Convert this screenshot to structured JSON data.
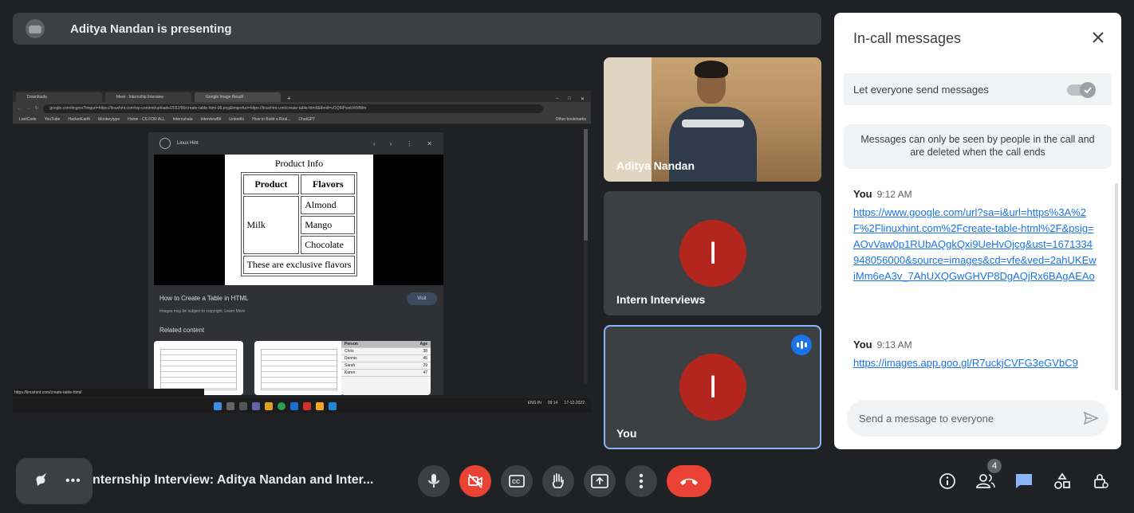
{
  "presenting": {
    "text": "Aditya Nandan is presenting"
  },
  "shared_screen": {
    "tabs": [
      "Downloads",
      "Meet - Internship Interview",
      "Google Image Result"
    ],
    "address": "google.com/imgres?imgurl=https://linuxhint.com/wp-content/uploads/2022/06/create-table-html-06.png&imgrefurl=https://linuxhint.com/create-table-html/&tbnid=vOQ6tPwsbXtMMm",
    "bookmarks": [
      "LeetCode",
      "YouTube",
      "HackerEarth",
      "Monkeytype",
      "Home - CS FOR ALL",
      "Internshala",
      "InterviewBit",
      "LinkedIn",
      "How to Build a Real...",
      "ChatGPT"
    ],
    "other_bookmarks": "Other bookmarks",
    "site_name": "Linux Hint",
    "product_table": {
      "title": "Product Info",
      "headers": [
        "Product",
        "Flavors"
      ],
      "product": "Milk",
      "flavors": [
        "Almond",
        "Mango",
        "Chocolate"
      ],
      "footer": "These are exclusive flavors"
    },
    "caption": "How to Create a Table in HTML",
    "visit": "Visit",
    "copyright": "Images may be subject to copyright. Learn More",
    "related": "Related content",
    "related_table": {
      "headers": [
        "Person",
        "Age"
      ],
      "rows": [
        [
          "Chris",
          "38"
        ],
        [
          "Dennis",
          "45"
        ],
        [
          "Sarah",
          "29"
        ],
        [
          "Karen",
          "47"
        ]
      ]
    },
    "status_url": "https://linuxhint.com/create-table-html/",
    "tray": {
      "lang": "ENG IN",
      "time": "09:14",
      "date": "17-12-2022"
    }
  },
  "tiles": [
    {
      "name": "Aditya Nandan",
      "type": "video"
    },
    {
      "name": "Intern Interviews",
      "initial": "I"
    },
    {
      "name": "You",
      "initial": "I"
    }
  ],
  "panel": {
    "title": "In-call messages",
    "toggle_label": "Let everyone send messages",
    "toggle_on": true,
    "notice": "Messages can only be seen by people in the call and are deleted when the call ends",
    "messages": [
      {
        "sender": "You",
        "time": "9:12 AM",
        "text": "https://www.google.com/url?sa=i&url=https%3A%2F%2Flinuxhint.com%2Fcreate-table-html%2F&psig=AOvVaw0p1RUbAQgkQxi9UeHvOjcg&ust=1671334948056000&source=images&cd=vfe&ved=2ahUKEwiMm6eA3v_7AhUXQGwGHVP8DgAQjRx6BAgAEAo"
      },
      {
        "sender": "You",
        "time": "9:13 AM",
        "text": "https://images.app.goo.gl/R7uckjCVFG3eGVbC9"
      }
    ],
    "compose_placeholder": "Send a message to everyone"
  },
  "bottom": {
    "meeting_title": "nternship Interview: Aditya Nandan and Inter...",
    "people_count": "4"
  },
  "colors": {
    "accent": "#1a73e8",
    "end_call": "#ea4335",
    "avatar": "#b3261e"
  }
}
